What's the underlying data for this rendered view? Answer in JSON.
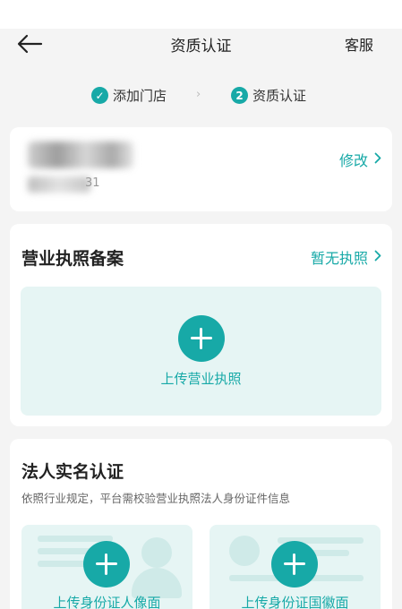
{
  "nav": {
    "title": "资质认证",
    "service": "客服"
  },
  "steps": [
    {
      "marker": "✓",
      "label": "添加门店"
    },
    {
      "marker": "2",
      "label": "资质认证"
    }
  ],
  "step_separator": "›",
  "shop": {
    "id_tail": "31",
    "edit_label": "修改"
  },
  "license": {
    "title": "营业执照备案",
    "no_license_label": "暂无执照",
    "upload_label": "上传营业执照"
  },
  "identity": {
    "title": "法人实名认证",
    "description": "依照行业规定，平台需校验营业执照法人身份证件信息",
    "front_label": "上传身份证人像面",
    "back_label": "上传身份证国徽面"
  },
  "colors": {
    "accent": "#17a9a7",
    "upload_bg": "#e6f5f4",
    "page_bg": "#f4f4f4"
  },
  "icons": {
    "back": "arrow-left-icon",
    "check": "check-circle-icon",
    "chevron": "chevron-right-icon",
    "plus": "plus-circle-icon"
  }
}
